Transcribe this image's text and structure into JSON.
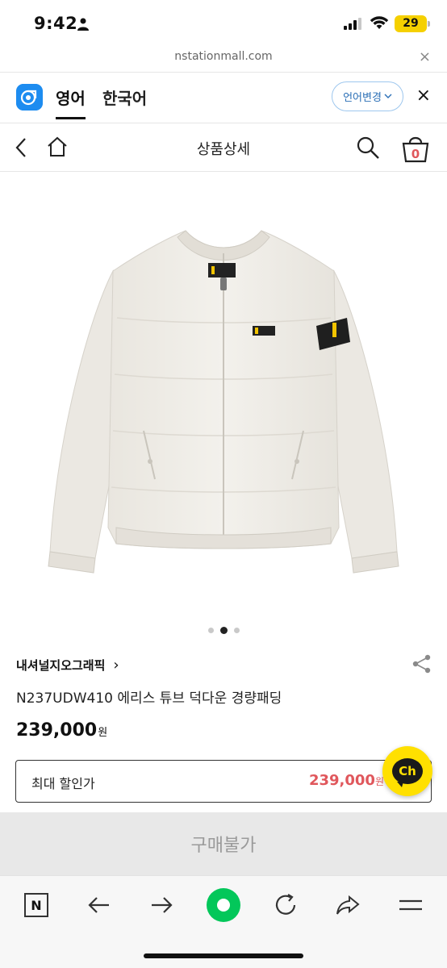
{
  "status_bar": {
    "time": "9:42",
    "battery": "29"
  },
  "url_bar": {
    "url": "nstationmall.com",
    "close_label": "×"
  },
  "translate_bar": {
    "tabs": [
      {
        "label": "영어",
        "active": true
      },
      {
        "label": "한국어",
        "active": false
      }
    ],
    "change_button": "언어변경",
    "close_label": "×"
  },
  "header": {
    "title": "상품상세",
    "cart_count": "0"
  },
  "carousel": {
    "total": 3,
    "current": 2
  },
  "product": {
    "brand": "내셔널지오그래픽",
    "brand_chevron": "›",
    "name": "N237UDW410 에리스 튜브 덕다운 경량패딩",
    "price": "239,000",
    "price_unit": "원",
    "max_discount_label": "최대 할인가",
    "max_discount_price": "239,000",
    "max_discount_unit": "원"
  },
  "chat": {
    "label": "Ch"
  },
  "buy": {
    "label": "구매불가"
  },
  "toolbar": {
    "items": [
      "naver-n-icon",
      "back-arrow-icon",
      "forward-arrow-icon",
      "green-home-icon",
      "refresh-icon",
      "share-forward-icon",
      "menu-icon"
    ],
    "naver_label": "N"
  },
  "colors": {
    "accent_yellow": "#ffe000",
    "price_red": "#e0575c",
    "naver_green": "#03c75a",
    "battery_yellow": "#f5d000",
    "papago_blue": "#1d8cf0"
  }
}
